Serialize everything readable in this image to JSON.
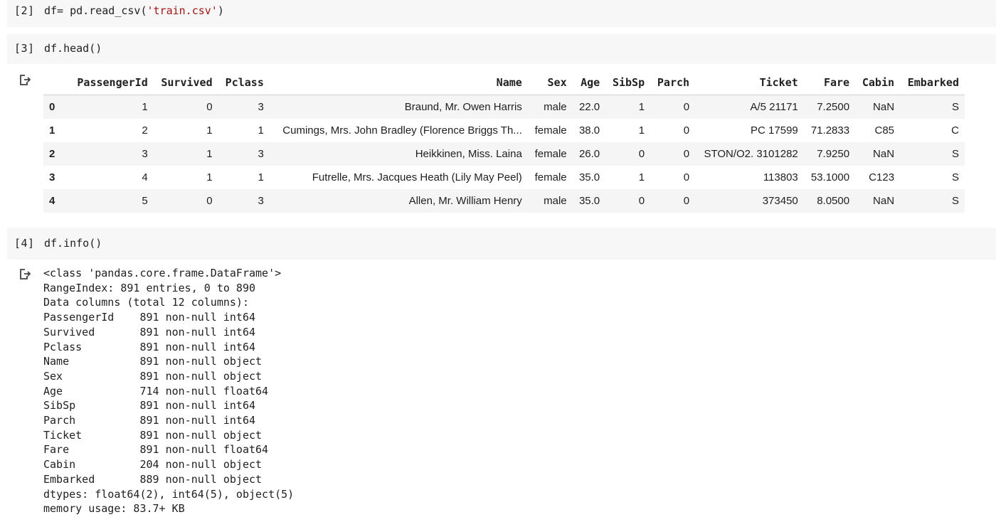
{
  "cells": [
    {
      "prompt": "[2]",
      "code_prefix": "df= pd.read_csv(",
      "code_string": "'train.csv'",
      "code_suffix": ")"
    },
    {
      "prompt": "[3]",
      "code": "df.head()"
    },
    {
      "prompt": "[4]",
      "code": "df.info()"
    }
  ],
  "output_icon": "output-arrow-icon",
  "dataframe": {
    "columns": [
      "",
      "PassengerId",
      "Survived",
      "Pclass",
      "Name",
      "Sex",
      "Age",
      "SibSp",
      "Parch",
      "Ticket",
      "Fare",
      "Cabin",
      "Embarked"
    ],
    "rows": [
      [
        "0",
        "1",
        "0",
        "3",
        "Braund, Mr. Owen Harris",
        "male",
        "22.0",
        "1",
        "0",
        "A/5 21171",
        "7.2500",
        "NaN",
        "S"
      ],
      [
        "1",
        "2",
        "1",
        "1",
        "Cumings, Mrs. John Bradley (Florence Briggs Th...",
        "female",
        "38.0",
        "1",
        "0",
        "PC 17599",
        "71.2833",
        "C85",
        "C"
      ],
      [
        "2",
        "3",
        "1",
        "3",
        "Heikkinen, Miss. Laina",
        "female",
        "26.0",
        "0",
        "0",
        "STON/O2. 3101282",
        "7.9250",
        "NaN",
        "S"
      ],
      [
        "3",
        "4",
        "1",
        "1",
        "Futrelle, Mrs. Jacques Heath (Lily May Peel)",
        "female",
        "35.0",
        "1",
        "0",
        "113803",
        "53.1000",
        "C123",
        "S"
      ],
      [
        "4",
        "5",
        "0",
        "3",
        "Allen, Mr. William Henry",
        "male",
        "35.0",
        "0",
        "0",
        "373450",
        "8.0500",
        "NaN",
        "S"
      ]
    ]
  },
  "info_output": [
    "<class 'pandas.core.frame.DataFrame'>",
    "RangeIndex: 891 entries, 0 to 890",
    "Data columns (total 12 columns):",
    "PassengerId    891 non-null int64",
    "Survived       891 non-null int64",
    "Pclass         891 non-null int64",
    "Name           891 non-null object",
    "Sex            891 non-null object",
    "Age            714 non-null float64",
    "SibSp          891 non-null int64",
    "Parch          891 non-null int64",
    "Ticket         891 non-null object",
    "Fare           891 non-null float64",
    "Cabin          204 non-null object",
    "Embarked       889 non-null object",
    "dtypes: float64(2), int64(5), object(5)",
    "memory usage: 83.7+ KB"
  ]
}
